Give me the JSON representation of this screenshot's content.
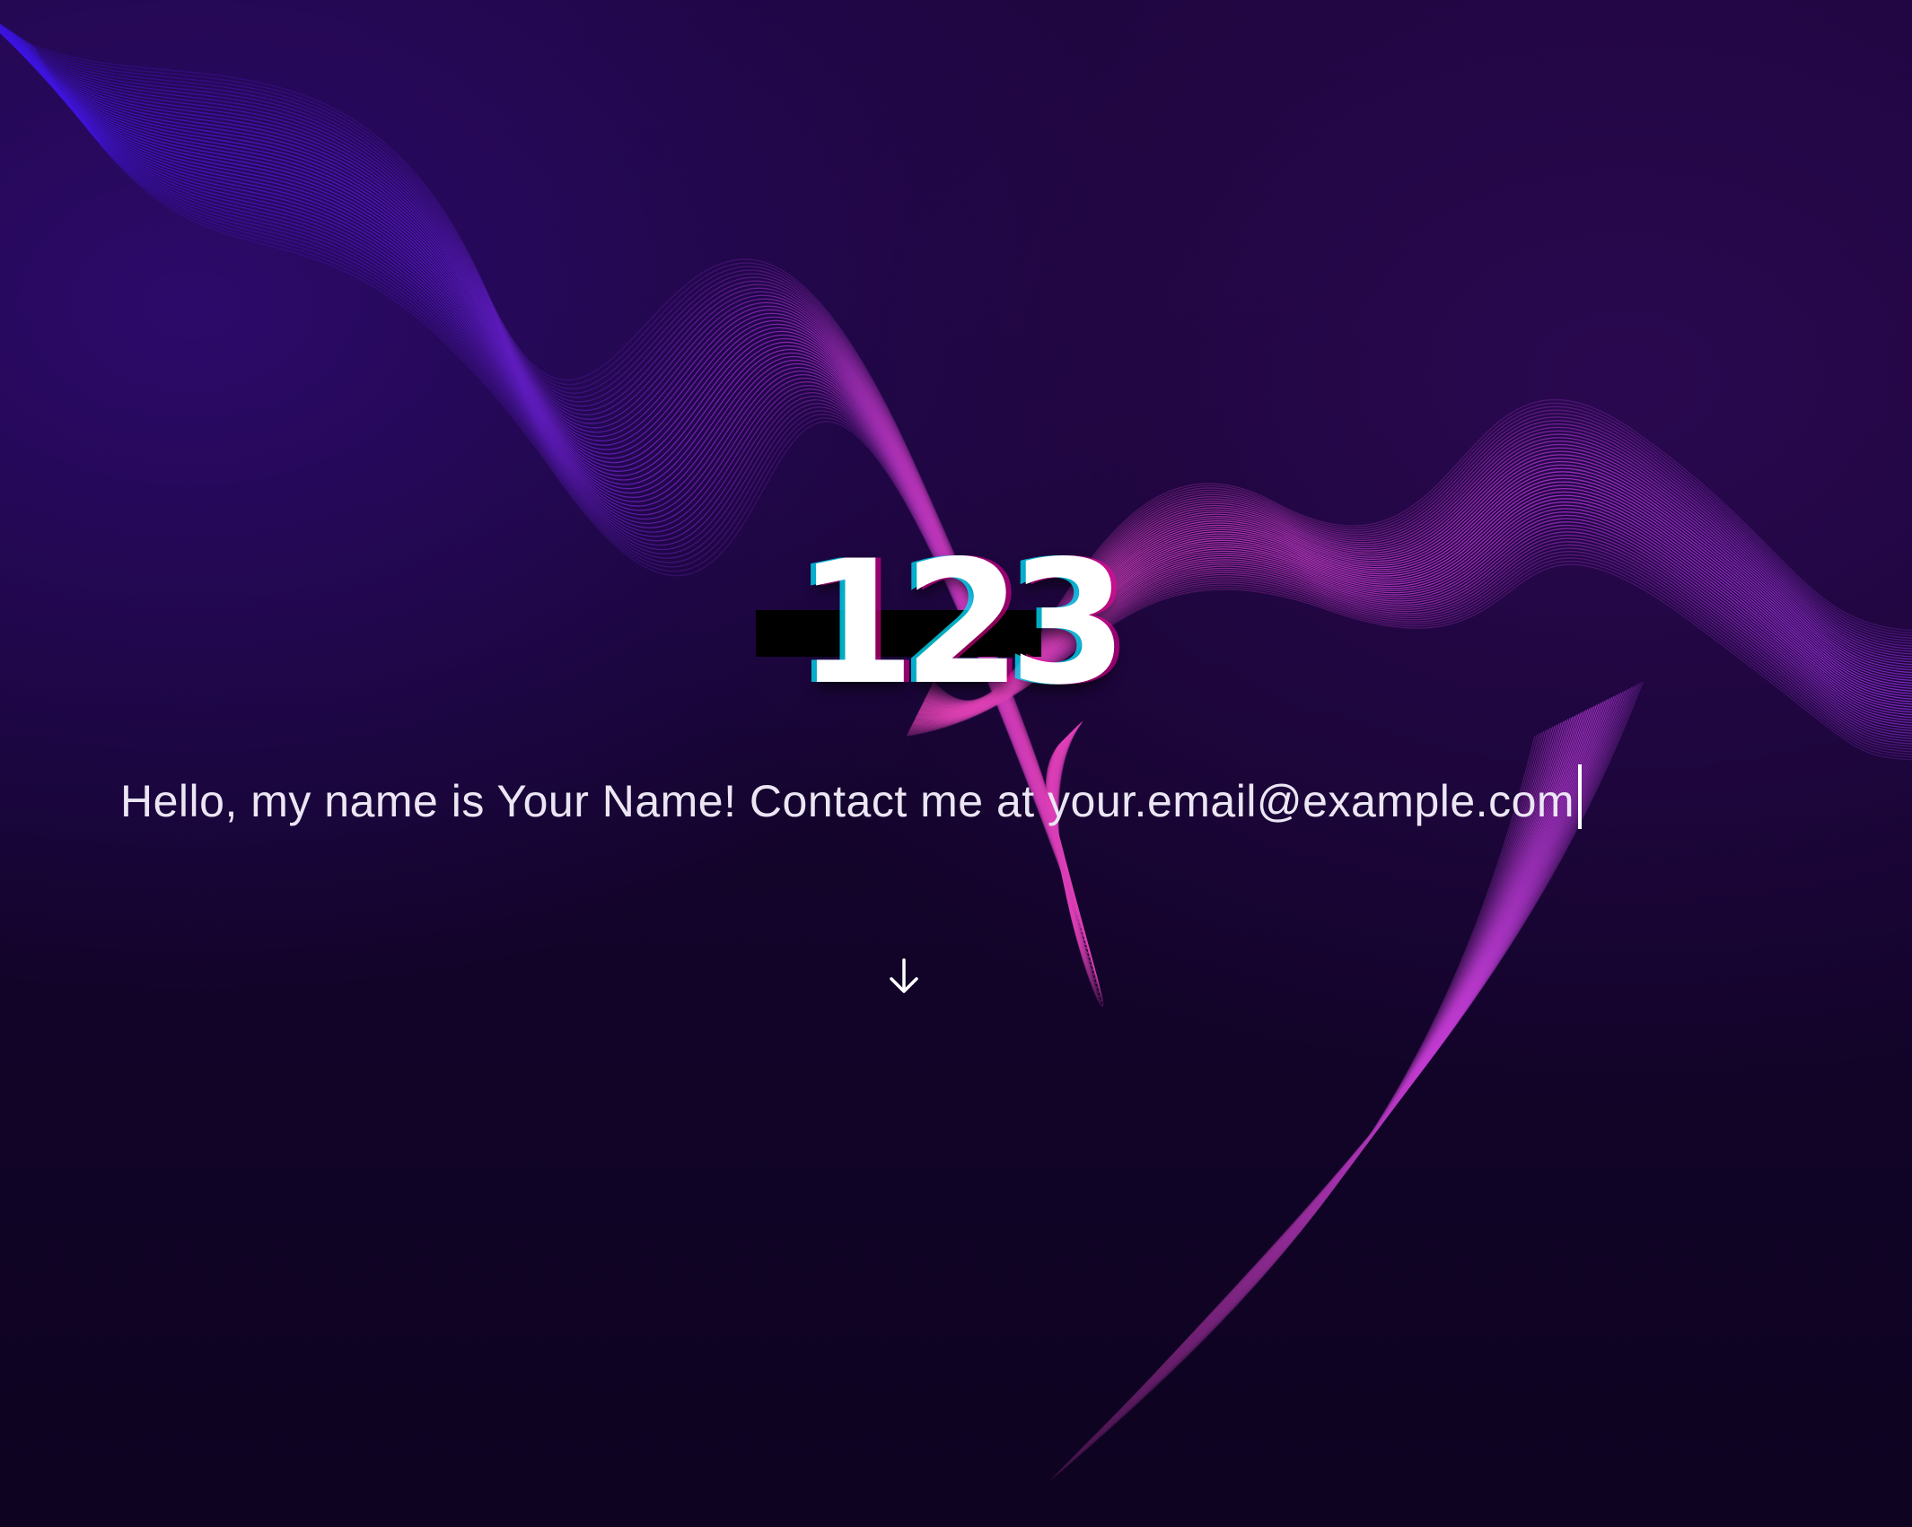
{
  "hero": {
    "title": "123",
    "tagline": "Hello, my name is Your Name! Contact me at your.email@example.com"
  },
  "icons": {
    "scroll_down": "arrow-down-icon",
    "text_cursor": "text-caret"
  },
  "colors": {
    "background_dark": "#12042a",
    "wave_pink": "#e23bb4",
    "wave_violet": "#8a2be2",
    "wave_blue": "#3a12d8",
    "text": "#ece6f4"
  }
}
